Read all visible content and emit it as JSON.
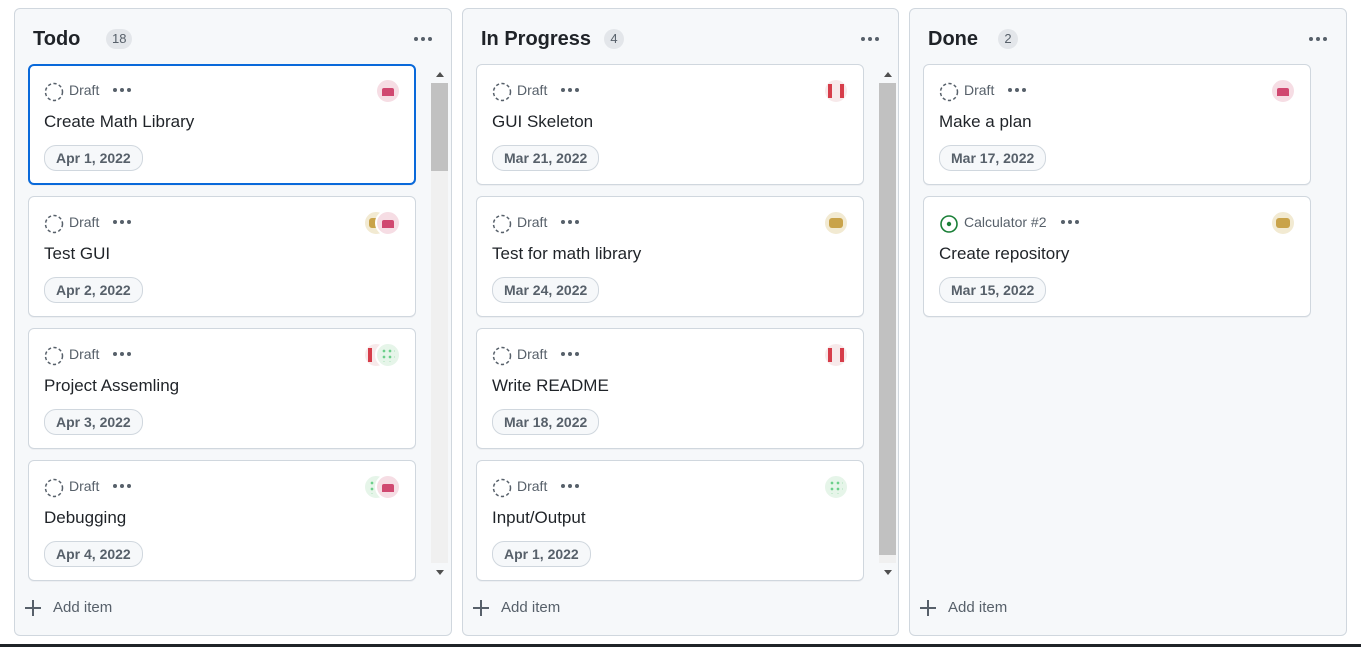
{
  "colors": {
    "accent": "#0969da",
    "issue_open": "#1a7f37",
    "muted": "#57606a"
  },
  "columns": [
    {
      "title": "Todo",
      "count": "18",
      "add_label": "Add item",
      "cards": [
        {
          "status": "Draft",
          "status_icon": "draft-circle-icon",
          "title": "Create Math Library",
          "date": "Apr 1, 2022",
          "avatars": [
            "pink"
          ],
          "selected": true
        },
        {
          "status": "Draft",
          "status_icon": "draft-circle-icon",
          "title": "Test GUI",
          "date": "Apr 2, 2022",
          "avatars": [
            "gold",
            "pink"
          ]
        },
        {
          "status": "Draft",
          "status_icon": "draft-circle-icon",
          "title": "Project Assemling",
          "date": "Apr 3, 2022",
          "avatars": [
            "red",
            "green"
          ]
        },
        {
          "status": "Draft",
          "status_icon": "draft-circle-icon",
          "title": "Debugging",
          "date": "Apr 4, 2022",
          "avatars": [
            "green",
            "pink"
          ]
        }
      ]
    },
    {
      "title": "In Progress",
      "count": "4",
      "add_label": "Add item",
      "cards": [
        {
          "status": "Draft",
          "status_icon": "draft-circle-icon",
          "title": "GUI Skeleton",
          "date": "Mar 21, 2022",
          "avatars": [
            "red"
          ]
        },
        {
          "status": "Draft",
          "status_icon": "draft-circle-icon",
          "title": "Test for math library",
          "date": "Mar 24, 2022",
          "avatars": [
            "gold"
          ]
        },
        {
          "status": "Draft",
          "status_icon": "draft-circle-icon",
          "title": "Write README",
          "date": "Mar 18, 2022",
          "avatars": [
            "red"
          ]
        },
        {
          "status": "Draft",
          "status_icon": "draft-circle-icon",
          "title": "Input/Output",
          "date": "Apr 1, 2022",
          "avatars": [
            "green"
          ]
        }
      ]
    },
    {
      "title": "Done",
      "count": "2",
      "add_label": "Add item",
      "cards": [
        {
          "status": "Draft",
          "status_icon": "draft-circle-icon",
          "title": "Make a plan",
          "date": "Mar 17, 2022",
          "avatars": [
            "pink"
          ]
        },
        {
          "status": "Calculator #2",
          "status_icon": "issue-open-icon",
          "title": "Create repository",
          "date": "Mar 15, 2022",
          "avatars": [
            "gold"
          ]
        }
      ]
    }
  ]
}
